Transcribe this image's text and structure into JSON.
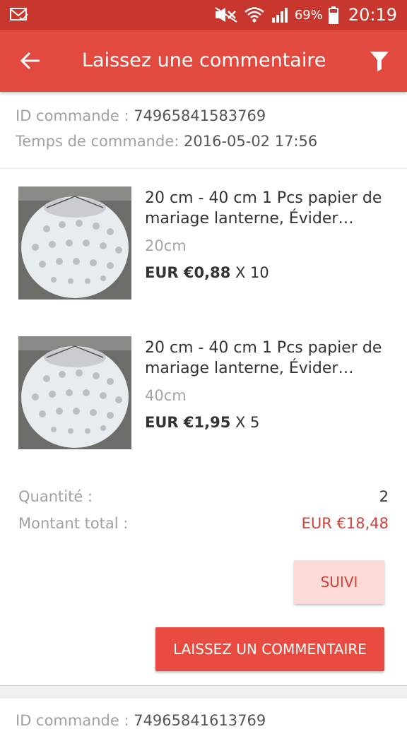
{
  "status_bar": {
    "battery": "69%",
    "time": "20:19",
    "icons": [
      "mail-icon",
      "mute-icon",
      "wifi-icon",
      "signal-icon",
      "battery-icon"
    ]
  },
  "app_bar": {
    "title": "Laissez une commentaire",
    "back_icon": "arrow-left-icon",
    "filter_icon": "filter-icon"
  },
  "order": {
    "id_label": "ID commande : ",
    "id_value": "74965841583769",
    "time_label": "Temps de commande: ",
    "time_value": "2016-05-02 17:56"
  },
  "items": [
    {
      "title": "20 cm - 40 cm 1 Pcs papier de mariage lanterne, Évider lamp...",
      "variant": "20cm",
      "price": "EUR €0,88",
      "qty": " X 10"
    },
    {
      "title": "20 cm - 40 cm 1 Pcs papier de mariage lanterne, Évider lamp...",
      "variant": "40cm",
      "price": "EUR €1,95",
      "qty": " X 5"
    }
  ],
  "summary": {
    "quantity_label": "Quantité :",
    "quantity_value": "2",
    "total_label": "Montant total :",
    "total_value": "EUR €18,48"
  },
  "buttons": {
    "track": "SUIVI",
    "comment": "LAISSEZ UN COMMENTAIRE"
  },
  "next_order": {
    "id_label": "ID commande : ",
    "id_value": "74965841613769"
  },
  "colors": {
    "status_bar": "#c8372d",
    "app_bar": "#e34a3f",
    "accent": "#d2403a",
    "button_primary": "#e84b3f",
    "button_light": "#fbdcd9"
  }
}
